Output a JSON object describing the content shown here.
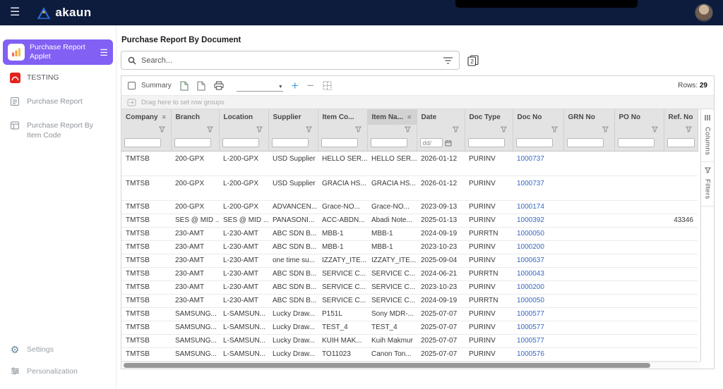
{
  "navbar": {
    "brand": "akaun"
  },
  "sidebar": {
    "applet_label": "Purchase Report Applet",
    "items": [
      {
        "label": "TESTING"
      },
      {
        "label": "Purchase Report"
      },
      {
        "label": "Purchase Report By Item Code"
      }
    ],
    "footer": [
      {
        "label": "Settings"
      },
      {
        "label": "Personalization"
      }
    ]
  },
  "main": {
    "title": "Purchase Report By Document",
    "search_placeholder": "Search...",
    "toolbar": {
      "summary": "Summary",
      "rows_label": "Rows:",
      "rows_count": "29"
    },
    "drag_hint": "Drag here to set row groups",
    "table": {
      "columns": [
        {
          "label": "Company",
          "menu": true
        },
        {
          "label": "Branch"
        },
        {
          "label": "Location"
        },
        {
          "label": "Supplier"
        },
        {
          "label": "Item Co..."
        },
        {
          "label": "Item Na...",
          "menu": true,
          "highlight": true
        },
        {
          "label": "Date",
          "filter": "date",
          "date_placeholder": "dd/"
        },
        {
          "label": "Doc Type"
        },
        {
          "label": "Doc No"
        },
        {
          "label": "GRN No"
        },
        {
          "label": "PO No"
        },
        {
          "label": "Ref. No"
        }
      ],
      "rows": [
        [
          "TMTSB",
          "200-GPX",
          "L-200-GPX",
          "USD Supplier",
          "HELLO SER...",
          "HELLO SER...",
          "2026-01-12",
          "PURINV",
          "1000737",
          "",
          "",
          ""
        ],
        [
          "TMTSB",
          "200-GPX",
          "L-200-GPX",
          "USD Supplier",
          "GRACIA HS...",
          "GRACIA HS...",
          "2026-01-12",
          "PURINV",
          "1000737",
          "",
          "",
          ""
        ],
        [
          "TMTSB",
          "200-GPX",
          "L-200-GPX",
          "ADVANCEN...",
          "Grace-NO...",
          "Grace-NO...",
          "2023-09-13",
          "PURINV",
          "1000174",
          "",
          "",
          ""
        ],
        [
          "TMTSB",
          "SES @ MID ...",
          "SES @ MID ...",
          "PANASONI...",
          "ACC-ABDN...",
          "Abadi Note...",
          "2025-01-13",
          "PURINV",
          "1000392",
          "",
          "",
          "43346"
        ],
        [
          "TMTSB",
          "230-AMT",
          "L-230-AMT",
          "ABC SDN B...",
          "MBB-1",
          "MBB-1",
          "2024-09-19",
          "PURRTN",
          "1000050",
          "",
          "",
          ""
        ],
        [
          "TMTSB",
          "230-AMT",
          "L-230-AMT",
          "ABC SDN B...",
          "MBB-1",
          "MBB-1",
          "2023-10-23",
          "PURINV",
          "1000200",
          "",
          "",
          ""
        ],
        [
          "TMTSB",
          "230-AMT",
          "L-230-AMT",
          "one time su...",
          "IZZATY_ITE...",
          "IZZATY_ITE...",
          "2025-09-04",
          "PURINV",
          "1000637",
          "",
          "",
          ""
        ],
        [
          "TMTSB",
          "230-AMT",
          "L-230-AMT",
          "ABC SDN B...",
          "SERVICE C...",
          "SERVICE C...",
          "2024-06-21",
          "PURRTN",
          "1000043",
          "",
          "",
          ""
        ],
        [
          "TMTSB",
          "230-AMT",
          "L-230-AMT",
          "ABC SDN B...",
          "SERVICE C...",
          "SERVICE C...",
          "2023-10-23",
          "PURINV",
          "1000200",
          "",
          "",
          ""
        ],
        [
          "TMTSB",
          "230-AMT",
          "L-230-AMT",
          "ABC SDN B...",
          "SERVICE C...",
          "SERVICE C...",
          "2024-09-19",
          "PURRTN",
          "1000050",
          "",
          "",
          ""
        ],
        [
          "TMTSB",
          "SAMSUNG...",
          "L-SAMSUN...",
          "Lucky Draw...",
          "P151L",
          "Sony MDR-...",
          "2025-07-07",
          "PURINV",
          "1000577",
          "",
          "",
          ""
        ],
        [
          "TMTSB",
          "SAMSUNG...",
          "L-SAMSUN...",
          "Lucky Draw...",
          "TEST_4",
          "TEST_4",
          "2025-07-07",
          "PURINV",
          "1000577",
          "",
          "",
          ""
        ],
        [
          "TMTSB",
          "SAMSUNG...",
          "L-SAMSUN...",
          "Lucky Draw...",
          "KUIH MAK...",
          "Kuih Makmur",
          "2025-07-07",
          "PURINV",
          "1000577",
          "",
          "",
          ""
        ],
        [
          "TMTSB",
          "SAMSUNG...",
          "L-SAMSUN...",
          "Lucky Draw...",
          "TO11023",
          "Canon Ton...",
          "2025-07-07",
          "PURINV",
          "1000576",
          "",
          "",
          ""
        ]
      ]
    },
    "side_tabs": [
      {
        "label": "Columns"
      },
      {
        "label": "Filters"
      }
    ]
  }
}
